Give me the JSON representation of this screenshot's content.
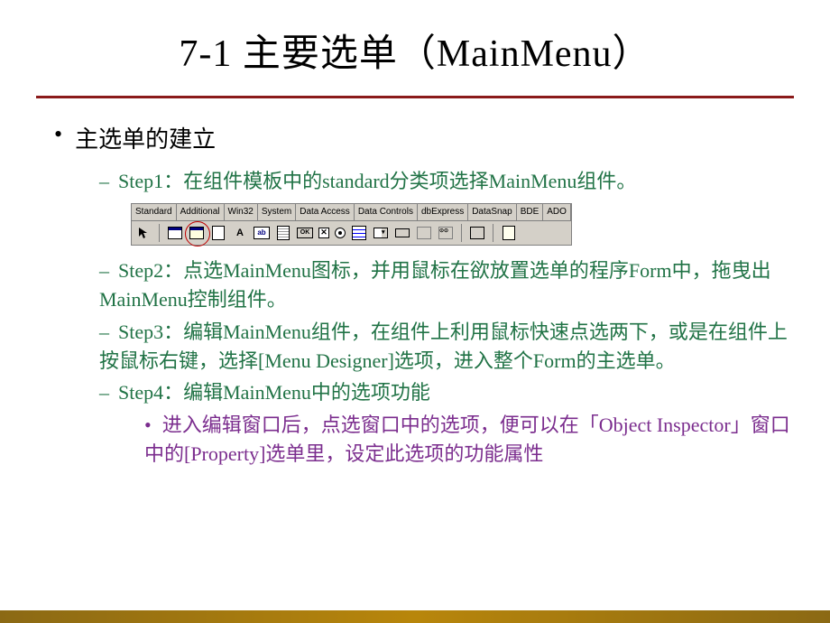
{
  "title": "7-1 主要选单（MainMenu）",
  "heading_level1": "主选单的建立",
  "steps": {
    "step1": {
      "label": "Step1：",
      "text": "在组件模板中的standard分类项选择MainMenu组件。"
    },
    "step2": {
      "label": "Step2：",
      "text": "点选MainMenu图标，并用鼠标在欲放置选单的程序Form中，拖曳出MainMenu控制组件。"
    },
    "step3": {
      "label": "Step3：",
      "text": "编辑MainMenu组件，在组件上利用鼠标快速点选两下，或是在组件上按鼠标右键，选择[Menu Designer]选项，进入整个Form的主选单。"
    },
    "step4": {
      "label": "Step4：",
      "text": "编辑MainMenu中的选项功能",
      "sub": "进入编辑窗口后，点选窗口中的选项，便可以在「Object Inspector」窗口中的[Property]选单里，设定此选项的功能属性"
    }
  },
  "toolbar": {
    "tabs": [
      "Standard",
      "Additional",
      "Win32",
      "System",
      "Data Access",
      "Data Controls",
      "dbExpress",
      "DataSnap",
      "BDE",
      "ADO"
    ],
    "icons": [
      "cursor",
      "frames",
      "mainmenu-circled",
      "popupmenu",
      "label-A",
      "edit-ab",
      "memo",
      "button-ok",
      "checkbox",
      "radiobutton",
      "listbox",
      "combobox",
      "scrollbar",
      "groupbox",
      "radiogroup",
      "panel",
      "actionlist"
    ]
  }
}
